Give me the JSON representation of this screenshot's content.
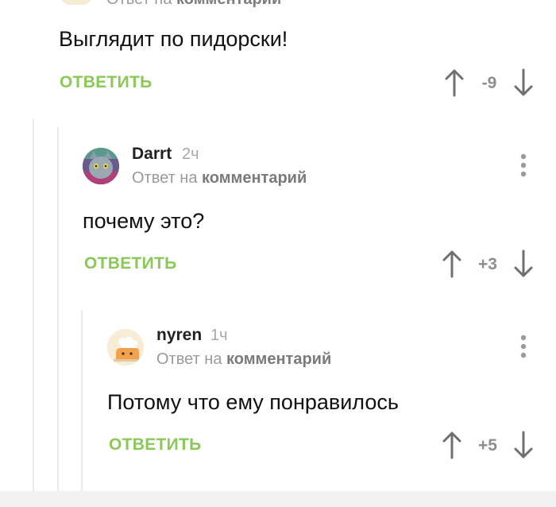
{
  "comments": [
    {
      "header": {
        "reply_prefix": "Ответ на",
        "reply_link": "комментарий"
      },
      "text": "Выглядит по пидорски!",
      "reply_label": "ОТВЕТИТЬ",
      "rating": "-9"
    },
    {
      "username": "Darrt",
      "time": "2ч",
      "reply_prefix": "Ответ на",
      "reply_link": "комментарий",
      "text": "почему это?",
      "reply_label": "ОТВЕТИТЬ",
      "rating": "+3",
      "avatar_icon": "cat-avatar-icon"
    },
    {
      "username": "nyren",
      "time": "1ч",
      "reply_prefix": "Ответ на",
      "reply_link": "комментарий",
      "text": "Потому что ему понравилось",
      "reply_label": "ОТВЕТИТЬ",
      "rating": "+5",
      "avatar_icon": "chef-avatar-icon"
    }
  ],
  "colors": {
    "accent_green": "#8ac858",
    "text": "#111111",
    "meta_gray": "#9a9a9a",
    "arrow_gray": "#6f6f6f",
    "thread_line": "#ebebeb"
  }
}
